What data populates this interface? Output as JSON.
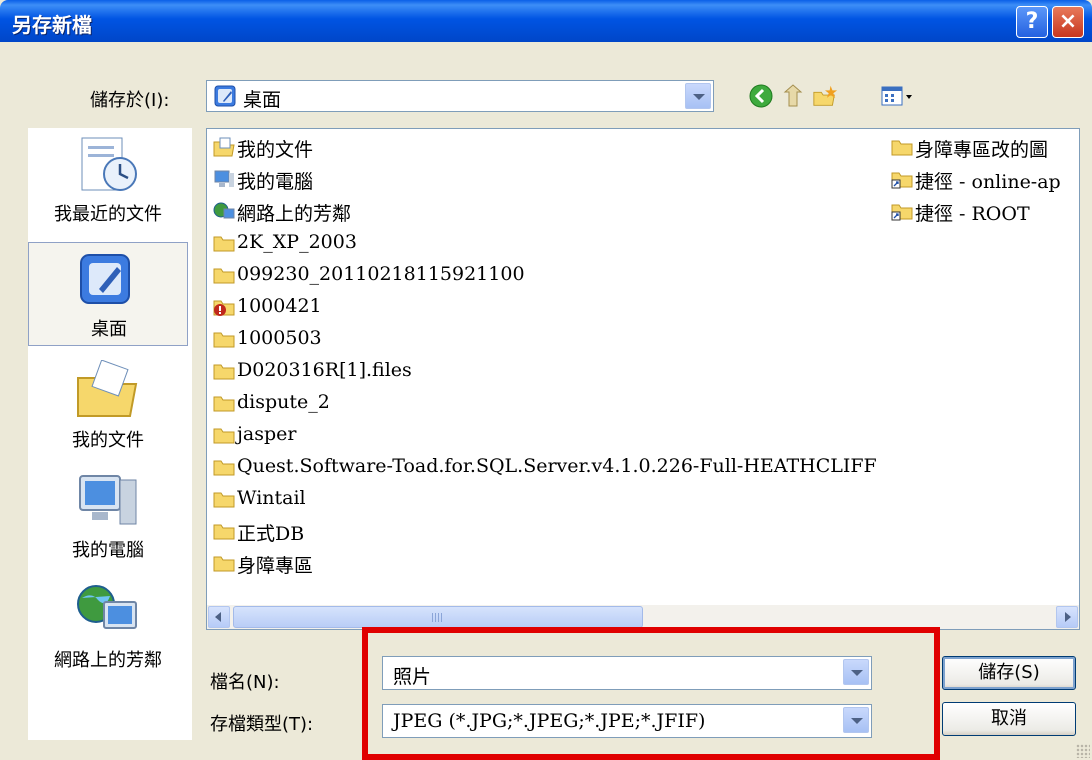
{
  "window": {
    "title": "另存新檔",
    "help": "?",
    "close": "×"
  },
  "save_in": {
    "label": "儲存於(I):",
    "value": "桌面"
  },
  "places": [
    {
      "label": "我最近的文件",
      "icon": "recent-documents-icon"
    },
    {
      "label": "桌面",
      "icon": "desktop-icon"
    },
    {
      "label": "我的文件",
      "icon": "my-documents-icon"
    },
    {
      "label": "我的電腦",
      "icon": "my-computer-icon"
    },
    {
      "label": "網路上的芳鄰",
      "icon": "network-places-icon"
    }
  ],
  "files": [
    {
      "name": "我的文件",
      "icon": "my-documents-icon"
    },
    {
      "name": "我的電腦",
      "icon": "my-computer-icon"
    },
    {
      "name": "網路上的芳鄰",
      "icon": "network-places-icon"
    },
    {
      "name": "2K_XP_2003",
      "icon": "folder-icon"
    },
    {
      "name": "099230_20110218115921100",
      "icon": "folder-icon"
    },
    {
      "name": "1000421",
      "icon": "folder-warning-icon"
    },
    {
      "name": "1000503",
      "icon": "folder-icon"
    },
    {
      "name": "D020316R[1].files",
      "icon": "folder-icon"
    },
    {
      "name": "dispute_2",
      "icon": "folder-icon"
    },
    {
      "name": "jasper",
      "icon": "folder-icon"
    },
    {
      "name": "Quest.Software-Toad.for.SQL.Server.v4.1.0.226-Full-HEATHCLIFF",
      "icon": "folder-icon"
    },
    {
      "name": "Wintail",
      "icon": "folder-icon"
    },
    {
      "name": "正式DB",
      "icon": "folder-icon"
    },
    {
      "name": "身障專區",
      "icon": "folder-icon"
    },
    {
      "name": "身障專區改的圖",
      "icon": "folder-icon"
    },
    {
      "name": "捷徑 - online-ap",
      "icon": "folder-shortcut-icon"
    },
    {
      "name": "捷徑 - ROOT",
      "icon": "folder-shortcut-icon"
    }
  ],
  "filename": {
    "label": "檔名(N):",
    "value": "照片"
  },
  "filetype": {
    "label": "存檔類型(T):",
    "value": "JPEG (*.JPG;*.JPEG;*.JPE;*.JFIF)"
  },
  "buttons": {
    "save": "儲存(S)",
    "cancel": "取消"
  },
  "colors": {
    "titlebar": "#0054E3",
    "face": "#ECE9D8",
    "highlight": "#E00000"
  }
}
